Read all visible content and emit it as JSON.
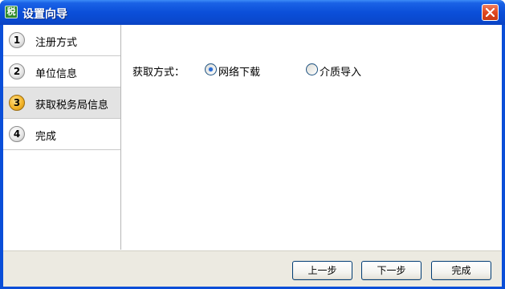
{
  "window": {
    "title": "设置向导",
    "icon_glyph": "税",
    "accent_color": "#0a4ed8"
  },
  "steps": [
    {
      "number": "1",
      "label": "注册方式",
      "active": false
    },
    {
      "number": "2",
      "label": "单位信息",
      "active": false
    },
    {
      "number": "3",
      "label": "获取税务局信息",
      "active": true
    },
    {
      "number": "4",
      "label": "完成",
      "active": false
    }
  ],
  "form": {
    "method_label": "获取方式：",
    "options": [
      {
        "label": "网络下载",
        "selected": true
      },
      {
        "label": "介质导入",
        "selected": false
      }
    ]
  },
  "buttons": {
    "prev": "上一步",
    "next": "下一步",
    "finish": "完成"
  }
}
